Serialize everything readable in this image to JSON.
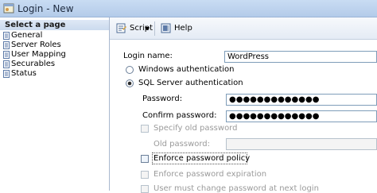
{
  "window": {
    "title": "Login - New"
  },
  "left_pane": {
    "header": "Select a page",
    "items": [
      {
        "label": "General"
      },
      {
        "label": "Server Roles"
      },
      {
        "label": "User Mapping"
      },
      {
        "label": "Securables"
      },
      {
        "label": "Status"
      }
    ]
  },
  "toolbar": {
    "script_label": "Script",
    "help_label": "Help",
    "script_icon": "script-icon",
    "help_icon": "help-icon"
  },
  "form": {
    "login_name_label": "Login name:",
    "login_name_value": "WordPress",
    "auth_windows_label": "Windows authentication",
    "auth_sql_label": "SQL Server authentication",
    "selected_auth": "sql",
    "password_label": "Password:",
    "password_value": "●●●●●●●●●●●●●",
    "confirm_password_label": "Confirm password:",
    "confirm_password_value": "●●●●●●●●●●●●●",
    "specify_old_password_label": "Specify old password",
    "old_password_label": "Old password:",
    "old_password_value": "",
    "enforce_policy_label": "Enforce password policy",
    "enforce_policy_checked": false,
    "enforce_expiration_label": "Enforce password expiration",
    "must_change_label": "User must change password at next login"
  },
  "colors": {
    "title_bar": "#c9dcf3",
    "page_header": "#dfe9f6",
    "field_border": "#7f9db9",
    "disabled_text": "#9a9a9a"
  }
}
